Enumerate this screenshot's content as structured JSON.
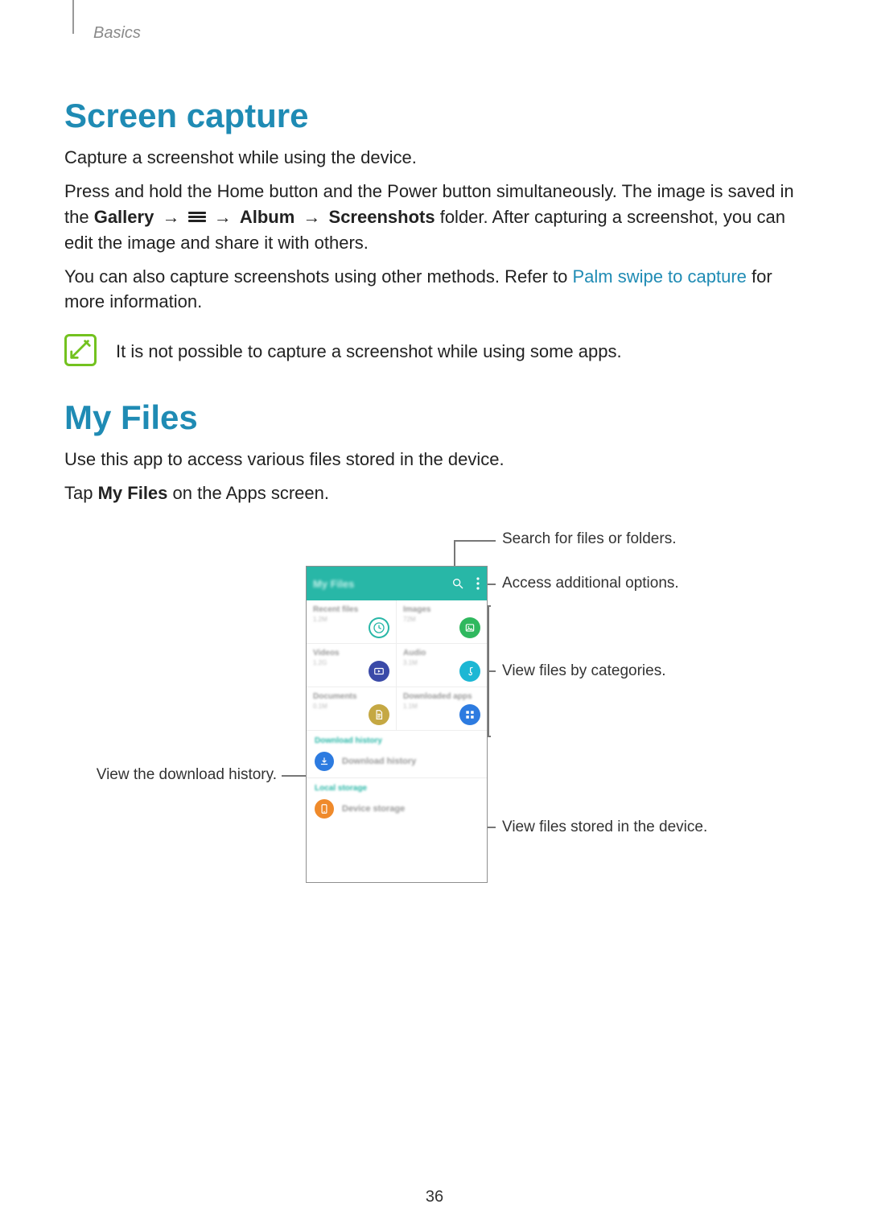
{
  "section_tag": "Basics",
  "page_number": "36",
  "screen_capture": {
    "heading": "Screen capture",
    "p1": "Capture a screenshot while using the device.",
    "p2a": "Press and hold the Home button and the Power button simultaneously. The image is saved in the ",
    "p2_gallery": "Gallery",
    "p2_arrow": "→",
    "p2_album": "Album",
    "p2_screenshots": "Screenshots",
    "p2b": " folder. After capturing a screenshot, you can edit the image and share it with others.",
    "p3a": "You can also capture screenshots using other methods. Refer to ",
    "p3_link": "Palm swipe to capture",
    "p3b": " for more information.",
    "note": "It is not possible to capture a screenshot while using some apps."
  },
  "my_files": {
    "heading": "My Files",
    "p1": "Use this app to access various files stored in the device.",
    "p2a": "Tap ",
    "p2_bold": "My Files",
    "p2b": " on the Apps screen."
  },
  "figure": {
    "callouts": {
      "search": "Search for files or folders.",
      "more": "Access additional options.",
      "categories": "View files by categories.",
      "download": "View the download history.",
      "storage": "View files stored in the device."
    },
    "phone": {
      "title": "My Files",
      "cats": [
        {
          "label": "Recent files",
          "sub": "1.2M"
        },
        {
          "label": "Images",
          "sub": "72M"
        },
        {
          "label": "Videos",
          "sub": "1.2G"
        },
        {
          "label": "Audio",
          "sub": "3.1M"
        },
        {
          "label": "Documents",
          "sub": "0.1M"
        },
        {
          "label": "Downloaded apps",
          "sub": "1.1M"
        }
      ],
      "dl_head": "Download history",
      "dl_label": "Download history",
      "ls_head": "Local storage",
      "ls_label": "Device storage"
    }
  }
}
